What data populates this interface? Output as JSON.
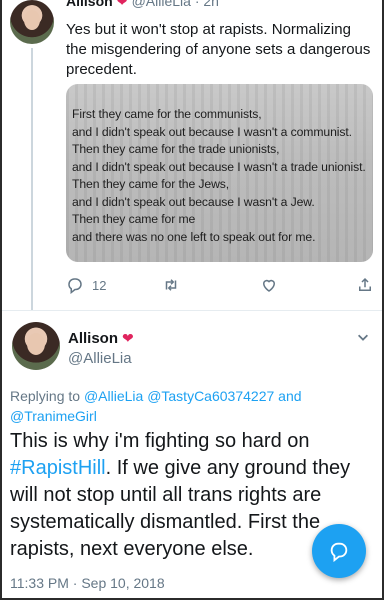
{
  "tweet1": {
    "author_name": "Allison",
    "handle_partial": "@AllieLia · 2h",
    "text": "Yes but it won't stop at rapists. Normalizing the misgendering of anyone sets a dangerous precedent.",
    "image_quote": "First they came for the communists,\nand I didn't speak out because I wasn't a communist.\nThen they came for the trade unionists,\nand I didn't speak out because I wasn't a trade unionist.\nThen they came for the Jews,\nand I didn't speak out because I wasn't a Jew.\nThen they came for me\nand there was no one left to speak out for me.",
    "reply_count": "12",
    "icons": [
      "reply-icon",
      "retweet-icon",
      "like-icon",
      "share-icon"
    ]
  },
  "tweet2": {
    "author_name": "Allison",
    "handle": "@AllieLia",
    "replying_prefix": "Replying to ",
    "replying_to": [
      "@AllieLia",
      "@TastyCa60374227",
      "and",
      "@TranimeGirl"
    ],
    "text_before": "This is why i'm fighting so hard on ",
    "hashtag": "#RapistHill",
    "text_after": ". If we give any ground they will not stop until all trans rights are systematically dismantled. First the rapists, next everyone else.",
    "timestamp": "11:33 PM · Sep 10, 2018"
  },
  "colors": {
    "accent": "#1da1f2",
    "heart": "#e0245e",
    "muted": "#657786",
    "text": "#14171a"
  }
}
